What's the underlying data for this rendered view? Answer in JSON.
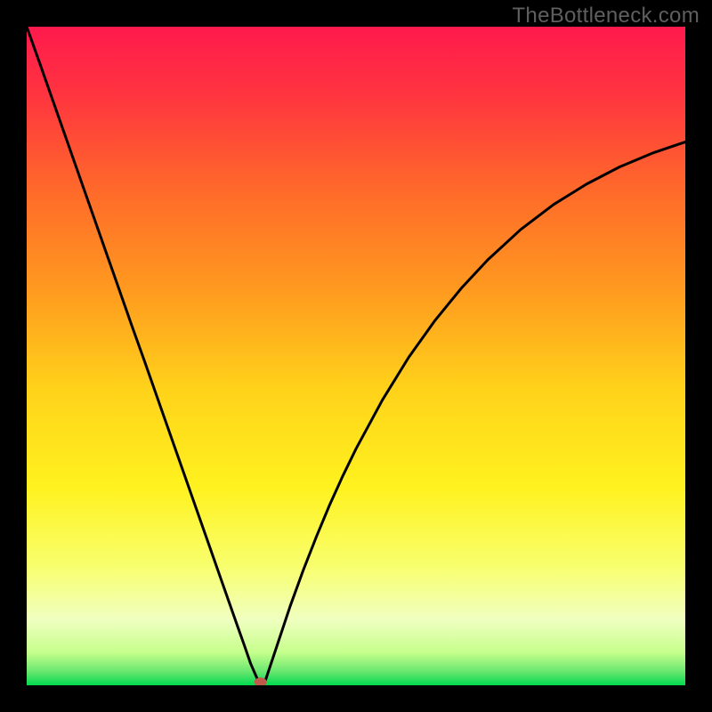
{
  "watermark": "TheBottleneck.com",
  "chart_data": {
    "type": "line",
    "title": "",
    "xlabel": "",
    "ylabel": "",
    "xlim": [
      0,
      100
    ],
    "ylim": [
      0,
      100
    ],
    "grid": false,
    "gradient_stops": [
      {
        "offset": 0.0,
        "color": "#ff1a4d"
      },
      {
        "offset": 0.1,
        "color": "#ff3340"
      },
      {
        "offset": 0.25,
        "color": "#ff6a2a"
      },
      {
        "offset": 0.4,
        "color": "#ff9a1f"
      },
      {
        "offset": 0.55,
        "color": "#ffd21a"
      },
      {
        "offset": 0.7,
        "color": "#fff21f"
      },
      {
        "offset": 0.82,
        "color": "#f8ff6e"
      },
      {
        "offset": 0.9,
        "color": "#f0ffc0"
      },
      {
        "offset": 0.95,
        "color": "#c6ff8c"
      },
      {
        "offset": 0.98,
        "color": "#66e66e"
      },
      {
        "offset": 1.0,
        "color": "#00d94f"
      }
    ],
    "series": [
      {
        "name": "bottleneck-curve",
        "stroke": "#000000",
        "x": [
          0,
          2,
          4,
          6,
          8,
          10,
          12,
          14,
          16,
          18,
          20,
          22,
          24,
          26,
          28,
          30,
          32,
          33,
          34,
          35,
          36,
          38,
          40,
          42,
          44,
          46,
          48,
          50,
          54,
          58,
          62,
          66,
          70,
          75,
          80,
          85,
          90,
          95,
          100
        ],
        "y": [
          100,
          94.4,
          88.7,
          83.0,
          77.3,
          71.6,
          65.9,
          60.2,
          54.5,
          48.9,
          43.2,
          37.5,
          31.8,
          26.1,
          20.4,
          14.7,
          9.0,
          6.2,
          3.3,
          1.0,
          0.0,
          6.0,
          12.0,
          17.5,
          22.6,
          27.4,
          31.8,
          35.9,
          43.3,
          49.8,
          55.4,
          60.3,
          64.6,
          69.2,
          73.0,
          76.1,
          78.7,
          80.8,
          82.5
        ]
      }
    ],
    "marker": {
      "name": "optimal-point",
      "x": 35.5,
      "y": 0.5,
      "color": "#c05a4a",
      "rx": 7,
      "ry": 5
    }
  }
}
